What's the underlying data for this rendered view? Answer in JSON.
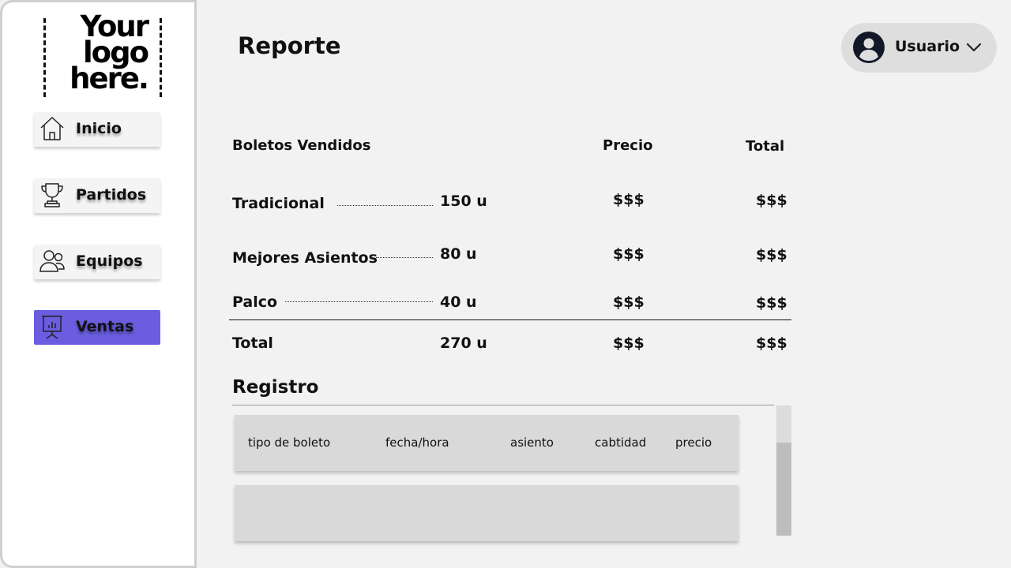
{
  "logo": {
    "text": "Your logo here."
  },
  "sidebar": {
    "items": [
      {
        "label": "Inicio",
        "icon": "home-icon"
      },
      {
        "label": "Partidos",
        "icon": "trophy-icon"
      },
      {
        "label": "Equipos",
        "icon": "users-icon"
      },
      {
        "label": "Ventas",
        "icon": "presentation-chart-icon",
        "active": true
      }
    ],
    "active_color": "#6a5de0"
  },
  "header": {
    "title": "Reporte",
    "user": {
      "name": "Usuario",
      "icon": "user-avatar-icon"
    }
  },
  "report": {
    "columns": {
      "tickets": "Boletos Vendidos",
      "price": "Precio",
      "total": "Total"
    },
    "rows": [
      {
        "type": "Tradicional",
        "quantity": "150 u",
        "price": "$$$",
        "total": "$$$"
      },
      {
        "type": "Mejores Asientos",
        "quantity": "80 u",
        "price": "$$$",
        "total": "$$$"
      },
      {
        "type": "Palco",
        "quantity": "40 u",
        "price": "$$$",
        "total": "$$$"
      }
    ],
    "summary": {
      "label": "Total",
      "quantity": "270 u",
      "price": "$$$",
      "total": "$$$"
    }
  },
  "registro": {
    "title": "Registro",
    "columns": [
      "tipo de boleto",
      "fecha/hora",
      "asiento",
      "cabtidad",
      "precio"
    ]
  }
}
